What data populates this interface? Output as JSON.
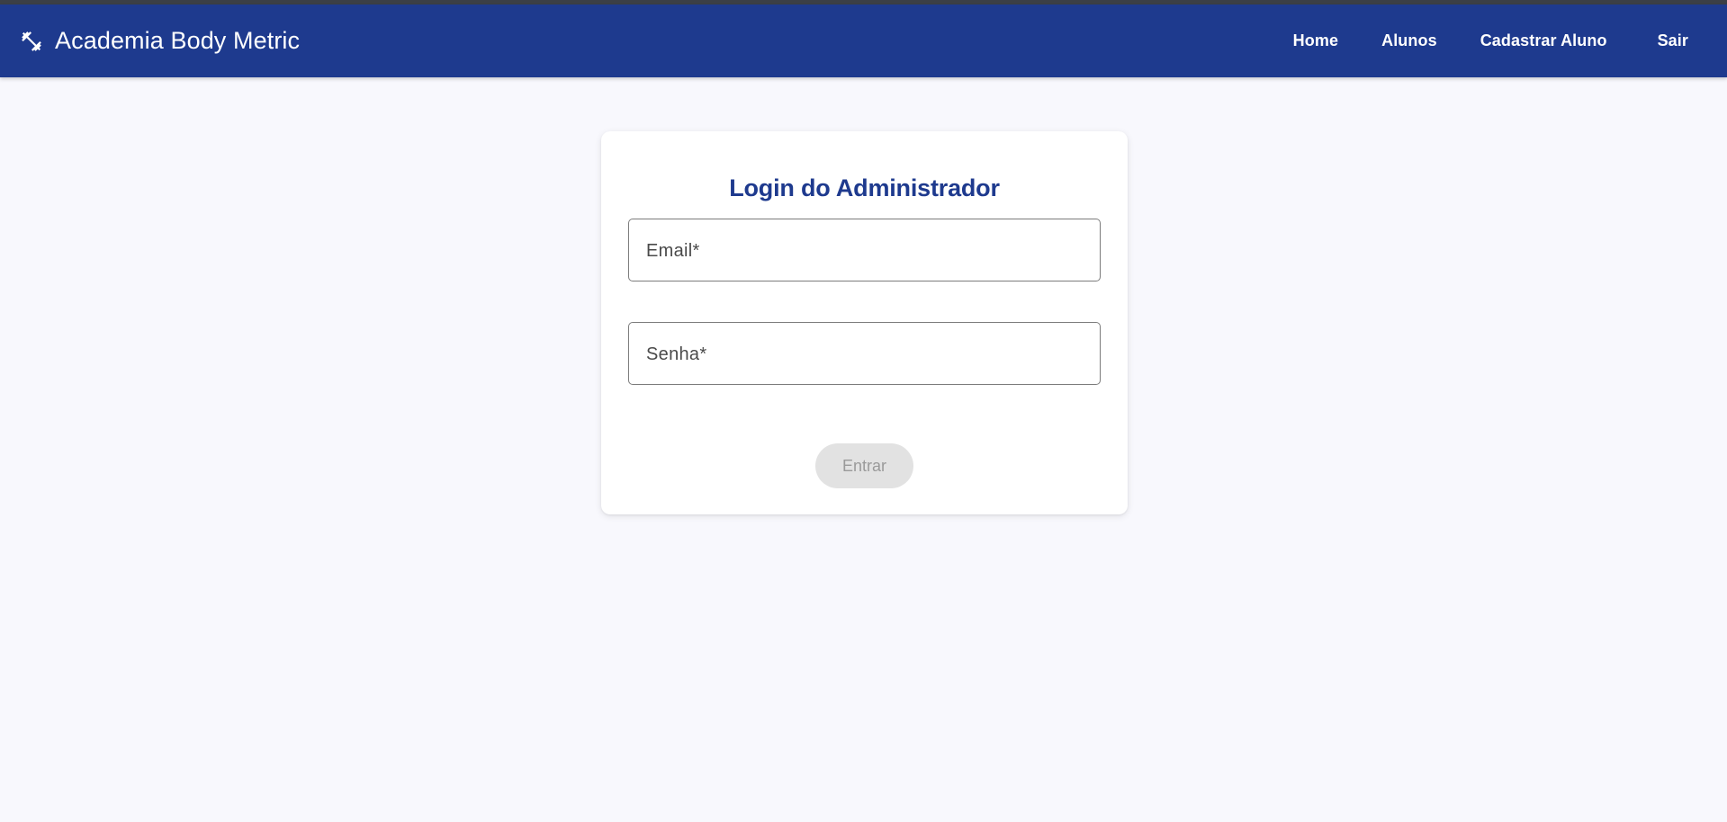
{
  "appbar": {
    "title": "Academia Body Metric",
    "icon": "dumbbell-icon",
    "background_color": "#1e3a8e"
  },
  "nav": {
    "items": [
      {
        "label": "Home"
      },
      {
        "label": "Alunos"
      },
      {
        "label": "Cadastrar Aluno"
      },
      {
        "label": "Sair"
      }
    ]
  },
  "login": {
    "title": "Login do Administrador",
    "email_label": "Email*",
    "email_value": "",
    "password_label": "Senha*",
    "password_value": "",
    "submit_label": "Entrar",
    "submit_state": "disabled"
  }
}
